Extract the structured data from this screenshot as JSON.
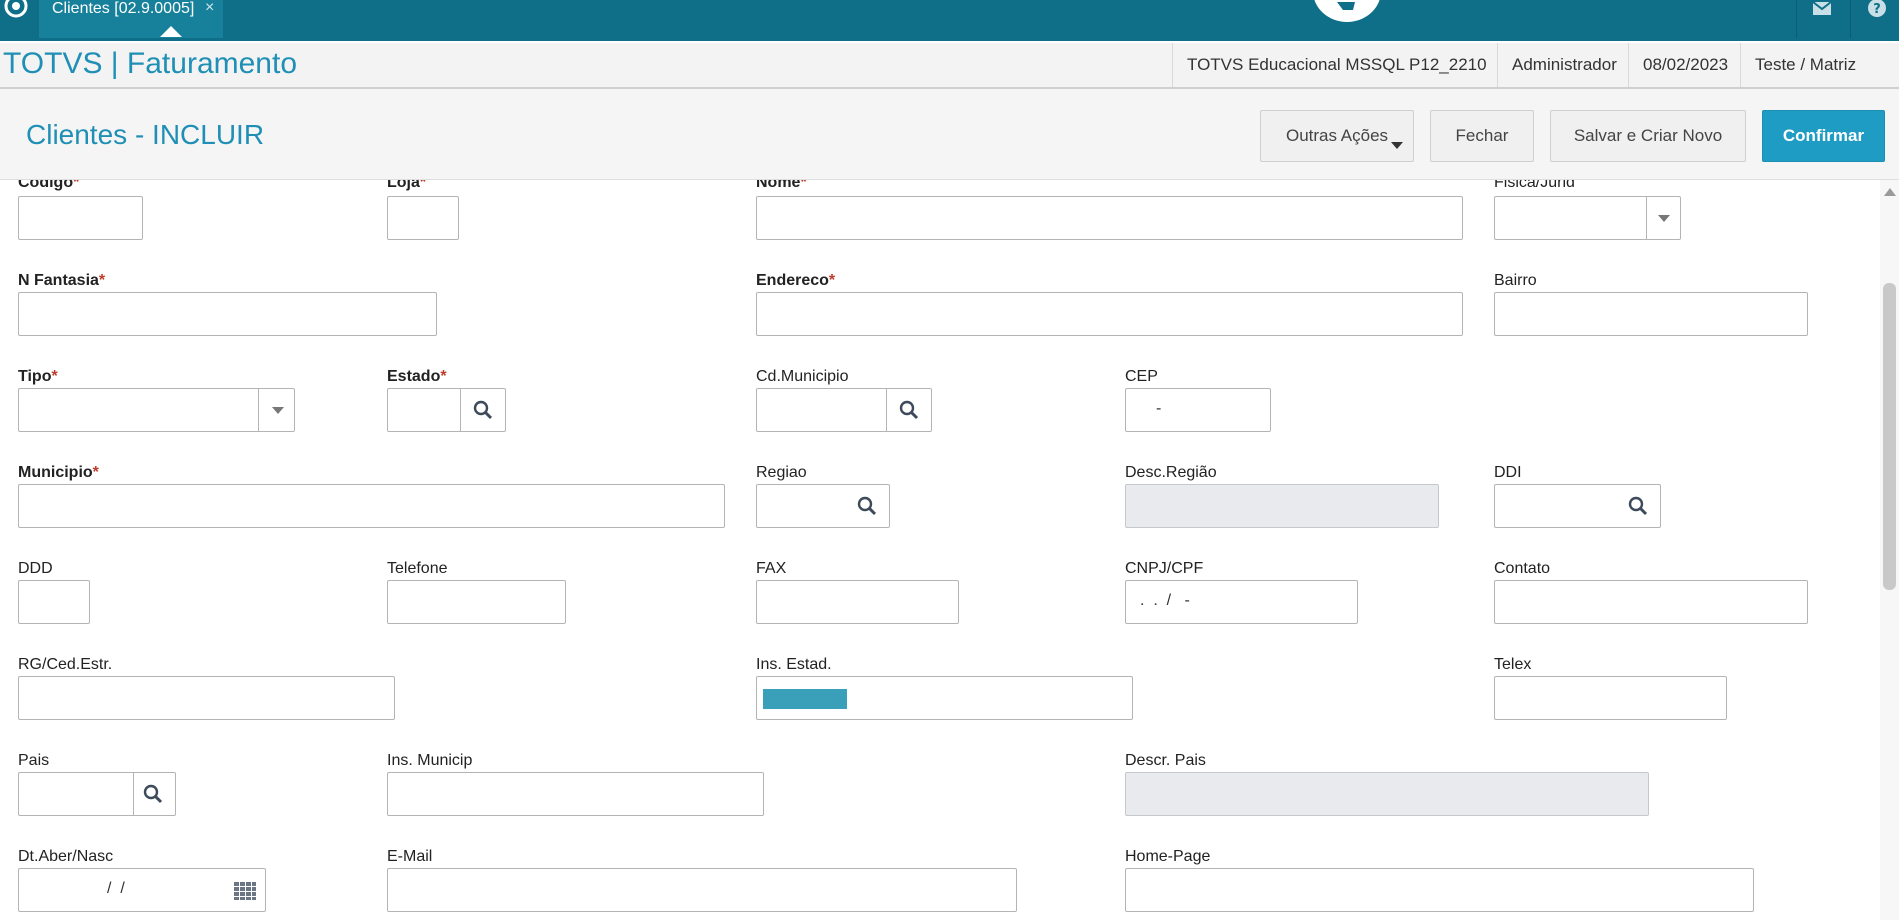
{
  "topbar": {
    "tab_label": "Clientes [02.9.0005]",
    "tab_close": "×"
  },
  "header": {
    "app_title": "TOTVS | Faturamento",
    "environment": "TOTVS Educacional MSSQL P12_2210",
    "user": "Administrador",
    "date": "08/02/2023",
    "branch": "Teste / Matriz"
  },
  "titlebar": {
    "page_title": "Clientes - INCLUIR",
    "outras_acoes": "Outras Ações",
    "fechar": "Fechar",
    "salvar_novo": "Salvar e Criar Novo",
    "confirmar": "Confirmar"
  },
  "form": {
    "codigo": "Codigo",
    "loja": "Loja",
    "nome": "Nome",
    "fisica_jurid": "Fisica/Jurid",
    "n_fantasia": "N Fantasia",
    "endereco": "Endereco",
    "bairro": "Bairro",
    "tipo": "Tipo",
    "estado": "Estado",
    "cd_municipio": "Cd.Municipio",
    "cep": "CEP",
    "cep_mask": "-",
    "municipio": "Municipio",
    "regiao": "Regiao",
    "desc_regiao": "Desc.Região",
    "ddi": "DDI",
    "ddd": "DDD",
    "telefone": "Telefone",
    "fax": "FAX",
    "cnpj_cpf": "CNPJ/CPF",
    "cnpj_mask": ".  .  /   -",
    "contato": "Contato",
    "rg_ced": "RG/Ced.Estr.",
    "ins_estad": "Ins. Estad.",
    "telex": "Telex",
    "pais": "Pais",
    "ins_municip": "Ins. Municip",
    "descr_pais": "Descr. Pais",
    "dt_aber_nasc": "Dt.Aber/Nasc",
    "dt_mask": "/  /",
    "email": "E-Mail",
    "home_page": "Home-Page",
    "required_mark": "*"
  },
  "colors": {
    "topbar": "#0f6f88",
    "accent": "#1f8fb5",
    "primary_button": "#1f9cc3",
    "required": "#c0392b"
  }
}
